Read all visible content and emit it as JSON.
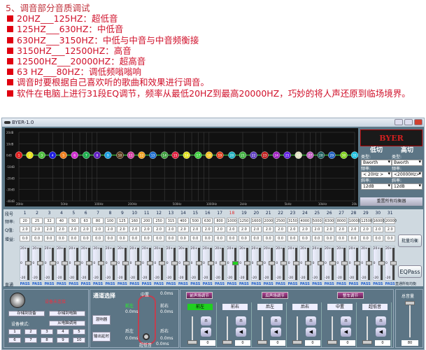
{
  "intro": {
    "heading": "5、调音部分音质调试",
    "items": [
      "20HZ___125HZ：超低音",
      "125HZ___630HZ：中低音",
      "630HZ___3150HZ：中低与中音与中音频衡接",
      "3150HZ___12500HZ：高音",
      "12500HZ___20000HZ：超高音",
      "63 HZ___80HZ：调低频嗡嗡响",
      "调音时要根据自己喜欢听的歌曲和效果进行调音。",
      "软件在电脑上进行31段EQ调节，频率从最低20HZ到最高20000HZ，巧妙的将人声还原到临场境界。"
    ]
  },
  "window": {
    "title": "BYER-1.0"
  },
  "chart_data": {
    "type": "line",
    "y_ticks": [
      "20dB",
      "10dB",
      "0dB",
      "-10dB",
      "-20dB",
      "-30dB",
      "-40dB"
    ],
    "ylim": [
      -40,
      20
    ],
    "x_ticks": [
      "20Hz",
      "50Hz",
      "100Hz",
      "200Hz",
      "500Hz",
      "1000Hz",
      "2kHz",
      "5kHz",
      "10kHz",
      "20k"
    ],
    "x_scale": "log",
    "grid": true,
    "points": [
      1,
      2,
      3,
      4,
      5,
      6,
      7,
      8,
      9,
      10,
      11,
      12,
      13,
      14,
      15,
      16,
      17,
      18,
      19,
      20,
      21,
      22,
      23,
      24,
      25,
      26,
      27,
      28,
      29,
      30,
      31
    ],
    "gains_db": [
      0,
      0,
      0,
      0,
      0,
      0,
      0,
      0,
      0,
      0,
      0,
      0,
      0,
      0,
      0,
      0,
      0,
      0,
      0,
      0,
      0,
      0,
      0,
      0,
      0,
      0,
      0,
      0,
      0,
      0,
      0
    ],
    "point_colors": [
      "#e02020",
      "#e8e020",
      "#50c040",
      "#2020e0",
      "#f08020",
      "#d030d0",
      "#20b050",
      "#6020c0",
      "#20a0e0",
      "#604020",
      "#d040a0",
      "#f0a020",
      "#2070d0",
      "#40a040",
      "#e02040",
      "#e0e020",
      "#40d040",
      "#f0c020",
      "#e04020",
      "#20b0c0",
      "#40b040",
      "#6040c0",
      "#c02020",
      "#a020c0",
      "#6020e0",
      "#e0e0c0",
      "#c060c0",
      "#206060",
      "#2060c0",
      "#80d020",
      "#20c0e0"
    ],
    "curve_color": "#40e040"
  },
  "right_panel": {
    "logo": "BYER",
    "low_cut": {
      "title": "低切",
      "type_label": "类型:",
      "type": "Bworth",
      "freq_label": "频率:",
      "freq": "< 20Hz >",
      "slope_label": "斜率:",
      "slope": "12dB"
    },
    "high_cut": {
      "title": "高切",
      "type_label": "类型:",
      "type": "Bworth",
      "freq_label": "频率:",
      "freq": "<20000Hz>",
      "slope_label": "斜率:",
      "slope": "12dB"
    },
    "reset": "重置所有均衡器"
  },
  "eq": {
    "row_labels": {
      "band": "段号",
      "freq": "频率:",
      "q": "Q值:",
      "gain": "增益:",
      "bypass": "直通"
    },
    "bands": [
      "1",
      "2",
      "3",
      "4",
      "5",
      "6",
      "7",
      "8",
      "9",
      "10",
      "11",
      "12",
      "13",
      "14",
      "15",
      "16",
      "17",
      "18",
      "19",
      "20",
      "21",
      "22",
      "23",
      "24",
      "25",
      "26",
      "27",
      "28",
      "29",
      "30",
      "31"
    ],
    "freqs": [
      "20",
      "25",
      "32",
      "40",
      "50",
      "63",
      "80",
      "100",
      "125",
      "160",
      "200",
      "250",
      "315",
      "400",
      "500",
      "630",
      "800",
      "1000",
      "1250",
      "1600",
      "2000",
      "2500",
      "3150",
      "4000",
      "5000",
      "6300",
      "8000",
      "10000",
      "12500",
      "16000",
      "20000"
    ],
    "q": "2.0",
    "gain": "0.0",
    "slider_top": "20+",
    "slider_mid": "0",
    "slider_bottom": "-20",
    "pass": "PASS",
    "batch_button": "批量均衡",
    "eqpass_button": "EQPass",
    "bypass_all": "直通所有均衡",
    "selected_band": 18
  },
  "device": {
    "status": "设备未连接",
    "save_device": "存储到设备",
    "save_pc": "存储到电脑",
    "mode_label": "设备模式:",
    "load_pc": "从电脑调用",
    "presets": [
      "1",
      "2",
      "3",
      "4",
      "5",
      "6",
      "7",
      "8",
      "9",
      "10"
    ]
  },
  "channel": {
    "title": "通道选择",
    "mixer": "混响器",
    "delay": "输出延时",
    "center": "中置",
    "front_left": "前左",
    "front_right": "前右",
    "rear_left": "后左",
    "rear_right": "后右",
    "sub": "超低音",
    "delay_val": "0.0ms"
  },
  "output": {
    "buttons": [
      "前声场调节",
      "后声场调节",
      "整车调节"
    ],
    "channels": [
      "前左",
      "前右",
      "后左",
      "后右",
      "中置",
      "超低音"
    ],
    "values": [
      "0",
      "0",
      "0",
      "0",
      "0",
      "0"
    ],
    "master_label": "总音量",
    "master_value": "80",
    "active_color": "#20d020"
  }
}
